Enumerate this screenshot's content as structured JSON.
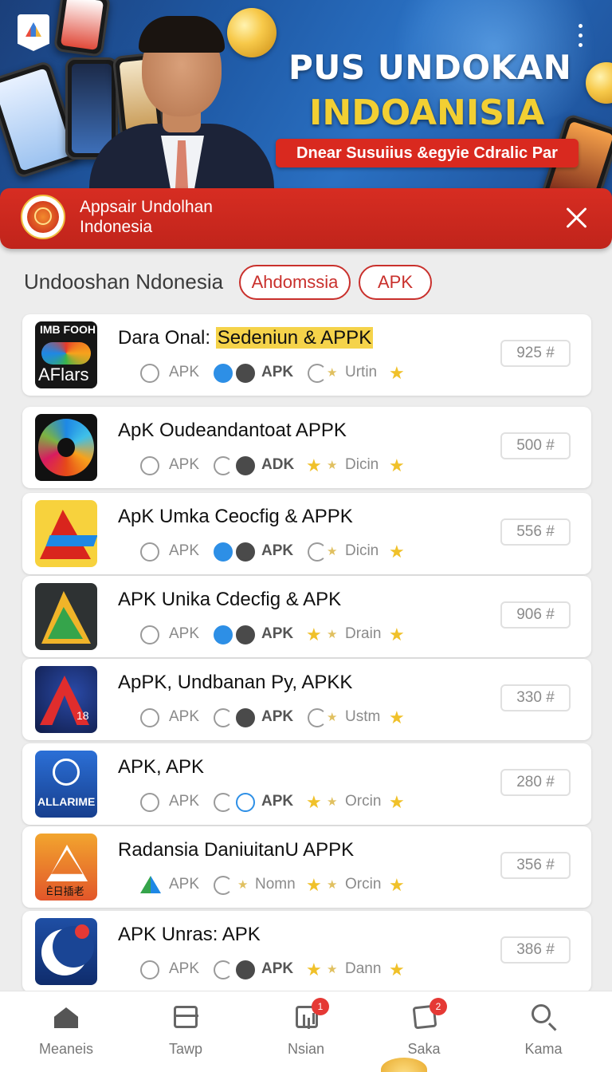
{
  "hero": {
    "title_line1": "PUS UNDOKAN",
    "title_line2": "INDOANISIA",
    "ribbon": "Dnear Susuiius &egyie Cdralic Par"
  },
  "redbar": {
    "line1": "Appsair Undolhan",
    "line2": "Indonesia"
  },
  "section": {
    "title": "Undooshan Ndonesia",
    "chips": [
      "Ahdomssia",
      "APK"
    ]
  },
  "apps": [
    {
      "name": "Dara Onal: ",
      "highlight": "Sedeniun & APPK",
      "m1": "APK",
      "m2": "APK",
      "m3": "Urtin",
      "count": "925 #",
      "icon_text1": "IMB FOOH",
      "icon_text2": "AFlars"
    },
    {
      "name": "ApK Oudeandantoat APPK",
      "highlight": "",
      "m1": "APK",
      "m2": "ADK",
      "m3": "Dicin",
      "count": "500 #"
    },
    {
      "name": "ApK Umka Ceocfig & APPK",
      "highlight": "",
      "m1": "APK",
      "m2": "APK",
      "m3": "Dicin",
      "count": "556 #"
    },
    {
      "name": "APK Unika Cdecfig & APK",
      "highlight": "",
      "m1": "APK",
      "m2": "APK",
      "m3": "Drain",
      "count": "906 #"
    },
    {
      "name": "ApPK, Undbanan Py, APKK",
      "highlight": "",
      "m1": "APK",
      "m2": "APK",
      "m3": "Ustm",
      "count": "330 #",
      "icon_text": "18"
    },
    {
      "name": "APK, APK",
      "highlight": "",
      "m1": "APK",
      "m2": "APK",
      "m3": "Orcin",
      "count": "280 #",
      "icon_text": "ALLARIME"
    },
    {
      "name": "Radansia DaniuitanU APPK",
      "highlight": "",
      "m1": "APK",
      "m2": "Nomn",
      "m3": "Orcin",
      "count": "356 #",
      "icon_text": "Ê日插老"
    },
    {
      "name": "APK Unras: APK",
      "highlight": "",
      "m1": "APK",
      "m2": "APK",
      "m3": "Dann",
      "count": "386 #"
    }
  ],
  "nav": [
    {
      "label": "Meaneis",
      "icon": "home-icon"
    },
    {
      "label": "Tawp",
      "icon": "box-icon"
    },
    {
      "label": "Nsian",
      "icon": "inbox-icon",
      "badge": "1"
    },
    {
      "label": "Saka",
      "icon": "saka-icon",
      "badge": "2"
    },
    {
      "label": "Kama",
      "icon": "search-icon"
    }
  ],
  "colors": {
    "accent": "#d72d22",
    "highlight": "#f5d34a",
    "star": "#f0c12a",
    "link_blue": "#2d8fe6"
  }
}
